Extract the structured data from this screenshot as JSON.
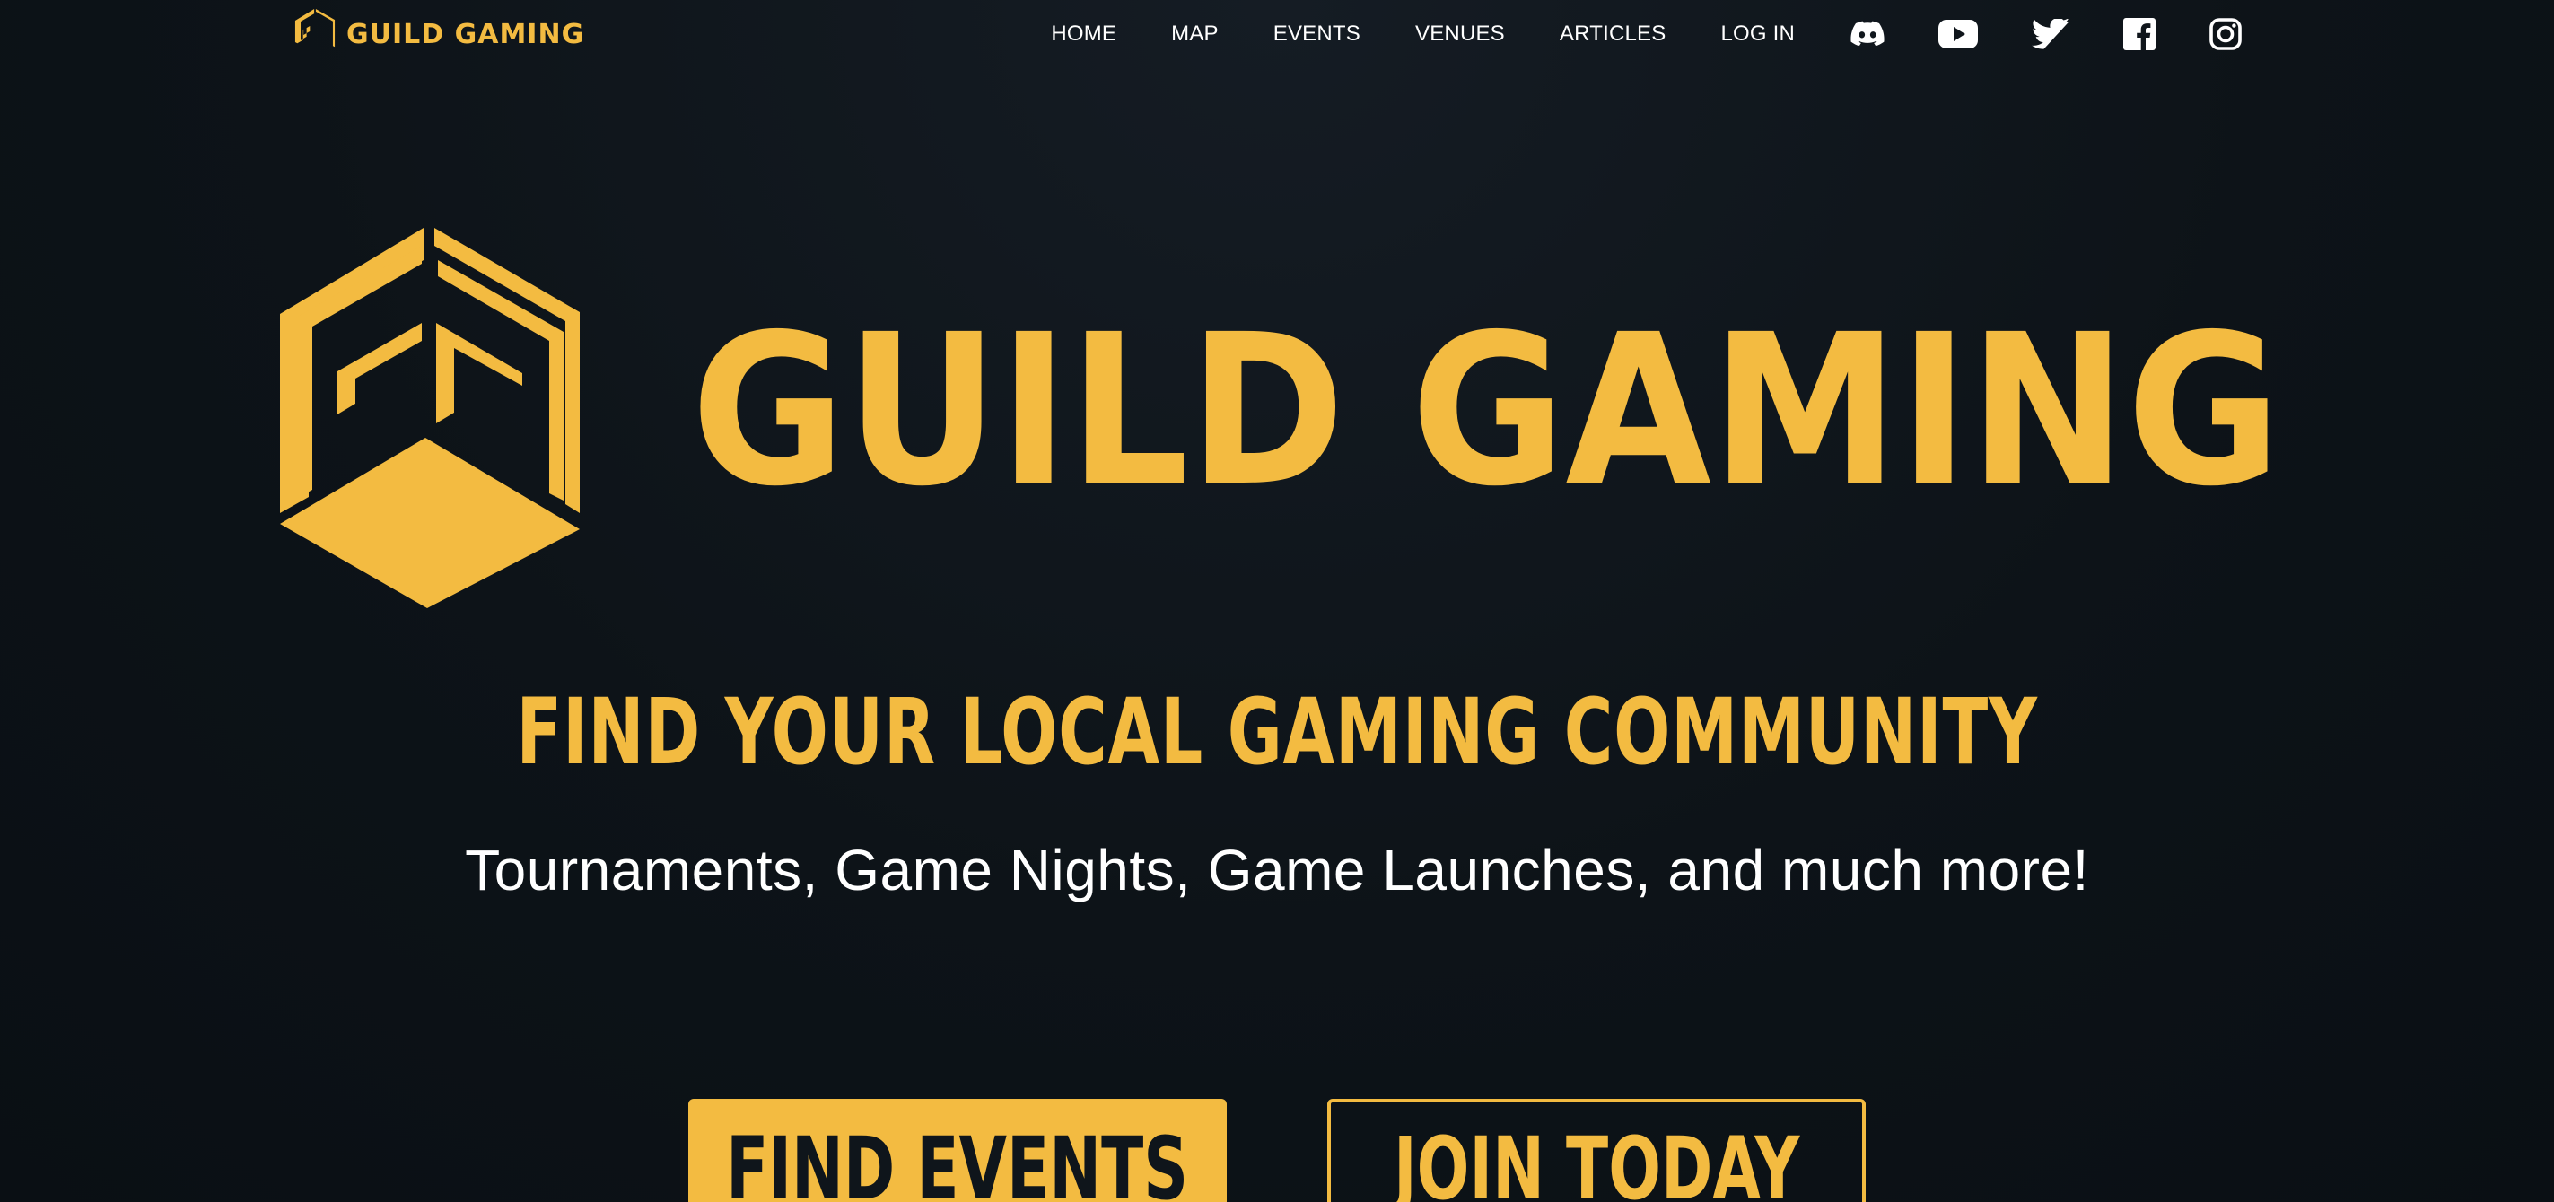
{
  "header": {
    "brand_name": "GUILD GAMING",
    "nav": [
      {
        "label": "HOME"
      },
      {
        "label": "MAP"
      },
      {
        "label": "EVENTS"
      },
      {
        "label": "VENUES"
      },
      {
        "label": "ARTICLES"
      },
      {
        "label": "LOG IN"
      }
    ],
    "social_icons": [
      "discord-icon",
      "youtube-icon",
      "twitter-icon",
      "facebook-icon",
      "instagram-icon"
    ]
  },
  "hero": {
    "title": "GUILD GAMING",
    "tagline": "FIND YOUR LOCAL GAMING COMMUNITY",
    "subtitle": "Tournaments, Game Nights, Game Launches, and much more!",
    "primary_button": "FIND EVENTS",
    "secondary_button": "JOIN TODAY"
  },
  "colors": {
    "accent": "#f3bb41",
    "background": "#0f151b",
    "text": "#ffffff"
  }
}
